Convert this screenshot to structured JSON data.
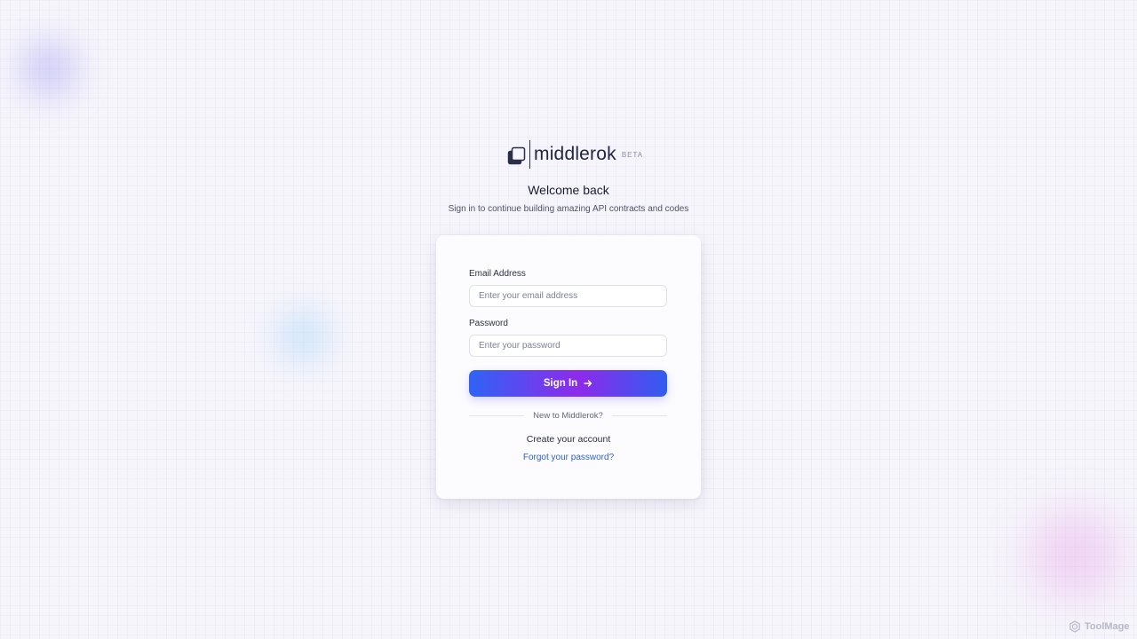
{
  "brand": {
    "name": "middlerok",
    "badge": "BETA"
  },
  "header": {
    "title": "Welcome back",
    "subtitle": "Sign in to continue building amazing API contracts and codes"
  },
  "form": {
    "email_label": "Email Address",
    "email_placeholder": "Enter your email address",
    "email_value": "",
    "password_label": "Password",
    "password_placeholder": "Enter your password",
    "password_value": "",
    "submit_label": "Sign In"
  },
  "footer_links": {
    "divider_text": "New to Middlerok?",
    "create_account": "Create your account",
    "forgot_password": "Forgot your password?"
  },
  "watermark": {
    "text": "ToolMage"
  },
  "icons": {
    "logo": "stacked-squares-icon",
    "submit": "arrow-right-icon",
    "watermark": "hexagon-icon"
  },
  "colors": {
    "accent_blue": "#2f63f5",
    "accent_purple": "#8e2bea",
    "link": "#2f5fc9"
  }
}
